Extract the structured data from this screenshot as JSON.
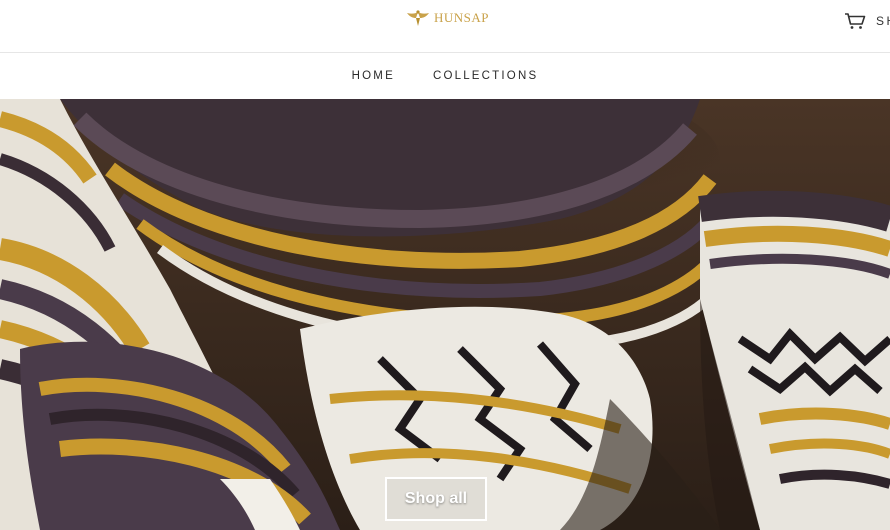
{
  "header": {
    "brand_name": "HUNSAP",
    "logo_icon": "winged-emblem-icon",
    "cart_icon": "cart-icon",
    "cart_label": "SH"
  },
  "nav": {
    "items": [
      {
        "label": "HOME"
      },
      {
        "label": "COLLECTIONS"
      }
    ]
  },
  "hero": {
    "image": "woven striped blanket photo",
    "cta_label": "Shop all"
  },
  "colors": {
    "brand_gold": "#c9a24a",
    "mustard": "#c99a2e",
    "deep_brown": "#3a2a1e",
    "plum": "#4a3b4a"
  }
}
